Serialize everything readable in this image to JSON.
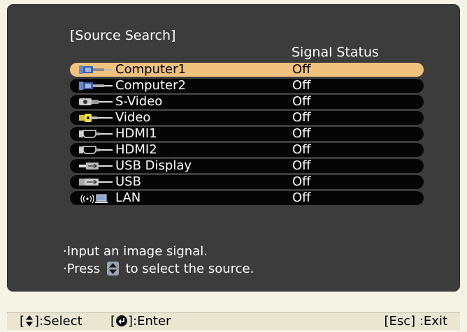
{
  "menu_title": "[Source Search]",
  "signal_header": "Signal Status",
  "sources": [
    {
      "label": "Computer1",
      "status": "Off",
      "icon": "vga-connector-icon",
      "selected": true
    },
    {
      "label": "Computer2",
      "status": "Off",
      "icon": "vga-connector-icon",
      "selected": false
    },
    {
      "label": "S-Video",
      "status": "Off",
      "icon": "svideo-connector-icon",
      "selected": false
    },
    {
      "label": "Video",
      "status": "Off",
      "icon": "rca-video-connector-icon",
      "selected": false
    },
    {
      "label": "HDMI1",
      "status": "Off",
      "icon": "hdmi-connector-icon",
      "selected": false
    },
    {
      "label": "HDMI2",
      "status": "Off",
      "icon": "hdmi-connector-icon",
      "selected": false
    },
    {
      "label": "USB Display",
      "status": "Off",
      "icon": "usb-connector-icon",
      "selected": false
    },
    {
      "label": "USB",
      "status": "Off",
      "icon": "usb-connector-icon",
      "selected": false
    },
    {
      "label": "LAN",
      "status": "Off",
      "icon": "wireless-lan-icon",
      "selected": false
    }
  ],
  "help": {
    "line1": "·Input an image signal.",
    "line2_pre": "·Press",
    "line2_post": "to select the source."
  },
  "footer": {
    "select_label": ":Select",
    "enter_label": ":Enter",
    "exit_label": "[Esc] :Exit"
  },
  "colors": {
    "panel": "#3c3c3c",
    "row": "#050505",
    "row_selected": "#f1c27d",
    "footer": "#eae6d2"
  }
}
